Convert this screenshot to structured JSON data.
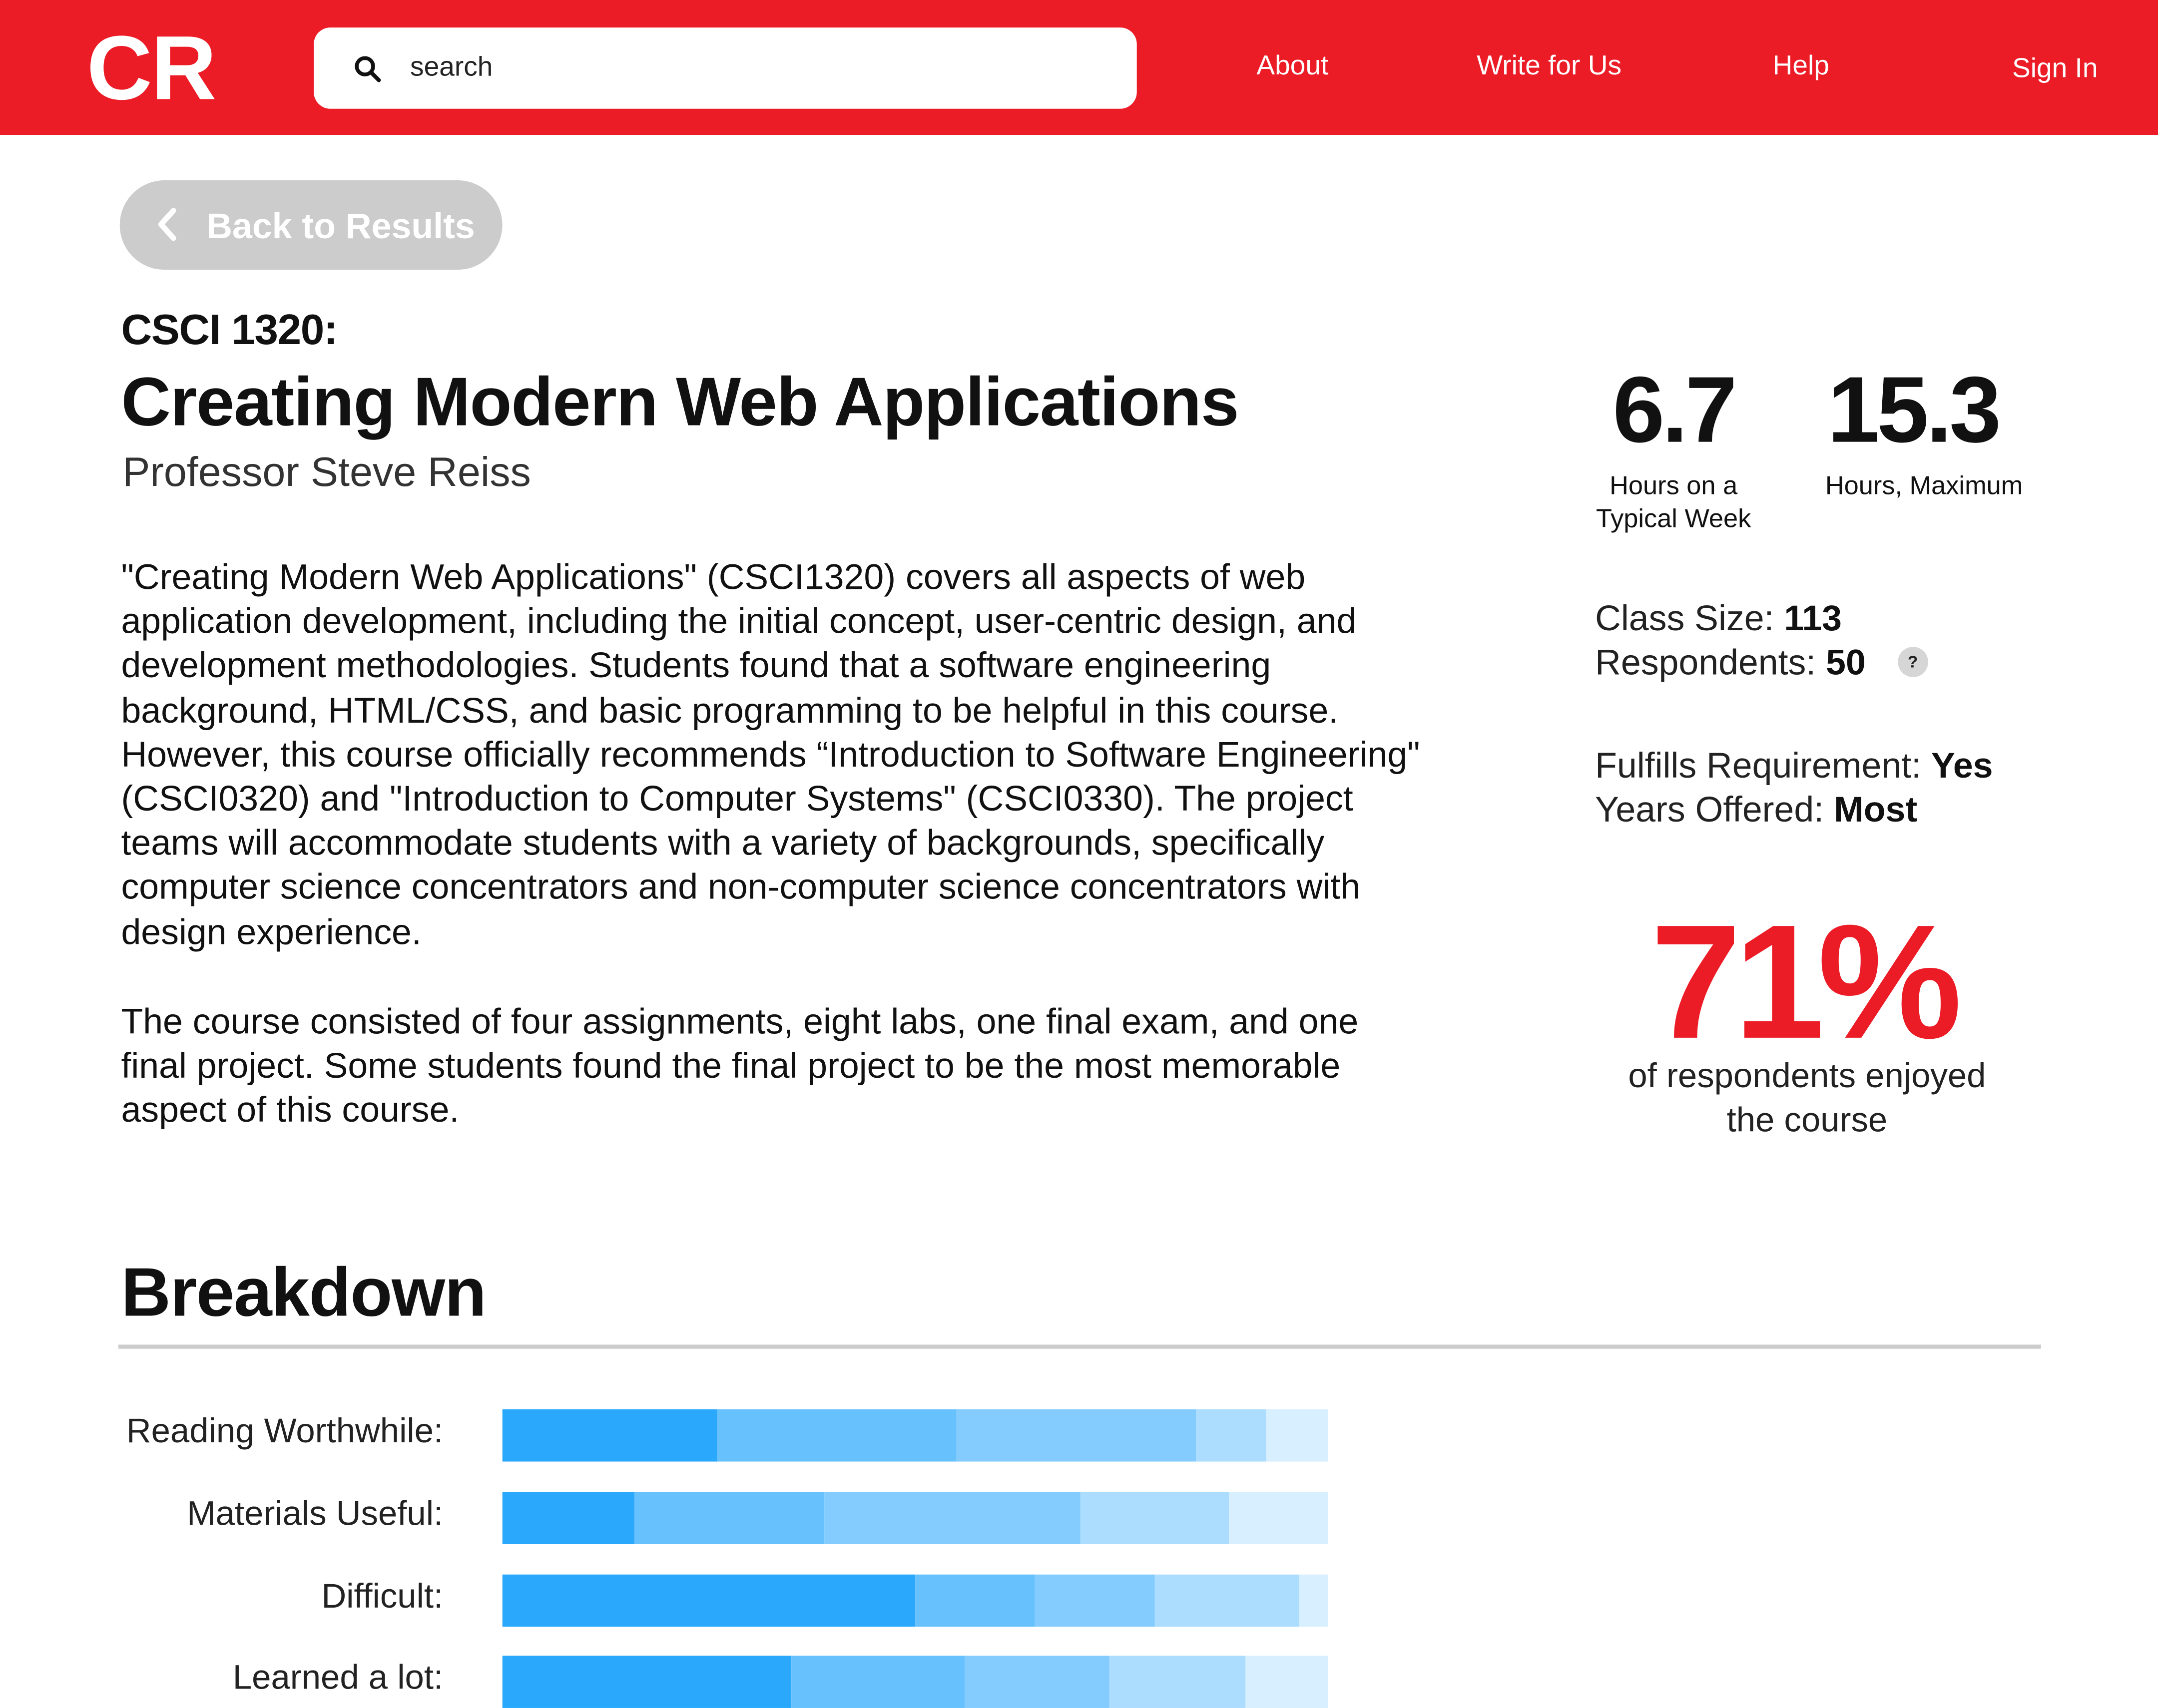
{
  "header": {
    "logo": "CR",
    "search_placeholder": "search",
    "nav": [
      "About",
      "Write for Us",
      "Help",
      "Sign In"
    ]
  },
  "back_button": {
    "label": "Back to Results"
  },
  "course": {
    "code": "CSCI 1320:",
    "title": "Creating Modern Web Applications",
    "professor": "Professor Steve Reiss",
    "description": [
      "\"Creating Modern Web Applications\" (CSCI1320) covers all aspects of web application development, including the initial concept, user-centric design, and development methodologies. Students found that a software engineering background, HTML/CSS, and basic programming to be helpful in this course. However, this course officially recommends “Introduction to Software Engineering\" (CSCI0320) and \"Introduction to Computer Systems\" (CSCI0330). The project teams will accommodate students with a variety of backgrounds, specifically computer science concentrators and non-computer science concentrators with design experience.",
      "The course consisted of four assignments, eight labs, one final exam, and one final project. Some students found the final project to be the most memorable aspect of this course."
    ]
  },
  "stats": {
    "hours_typical": {
      "value": "6.7",
      "caption": "Hours on a Typical Week"
    },
    "hours_max": {
      "value": "15.3",
      "caption": "Hours, Maximum"
    },
    "class_size": {
      "label": "Class Size:",
      "value": "113"
    },
    "respondents": {
      "label": "Respondents:",
      "value": "50",
      "help_icon": "?"
    },
    "fulfills_requirement": {
      "label": "Fulfills Requirement:",
      "value": "Yes"
    },
    "years_offered": {
      "label": "Years Offered:",
      "value": "Most"
    },
    "enjoyment": {
      "value": "71%",
      "caption": "of respondents enjoyed the course"
    }
  },
  "breakdown": {
    "title": "Breakdown",
    "colors": [
      "#29a8fc",
      "#67c1fd",
      "#83ccfd",
      "#acdcfe",
      "#d7effe"
    ],
    "rows": [
      {
        "label": "Reading Worthwhile:",
        "segments": [
          26,
          29,
          29,
          8.5,
          7.5
        ]
      },
      {
        "label": "Materials Useful:",
        "segments": [
          16,
          23,
          31,
          18,
          12
        ]
      },
      {
        "label": "Difficult:",
        "segments": [
          50,
          14.5,
          14.5,
          17.5,
          3.5
        ]
      },
      {
        "label": "Learned a lot:",
        "segments": [
          35,
          21,
          17.5,
          16.5,
          10
        ]
      }
    ]
  }
}
